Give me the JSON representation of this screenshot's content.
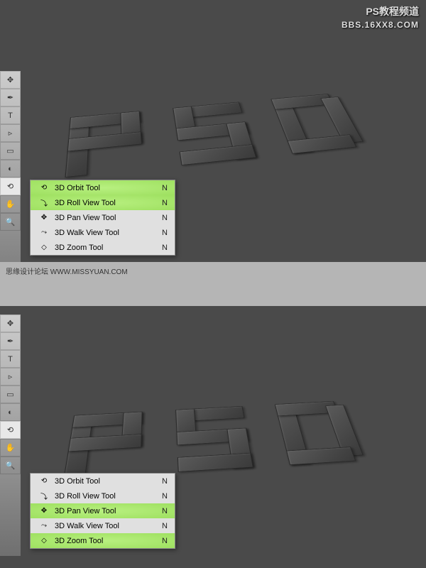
{
  "watermark": {
    "line1": "PS教程频道",
    "line2": "BBS.16XX8.COM"
  },
  "separator": {
    "text": "思缘设计论坛  WWW.MISSYUAN.COM"
  },
  "shortcut": "N",
  "menu_items": [
    {
      "label": "3D Orbit Tool",
      "icon": "⟲"
    },
    {
      "label": "3D Roll View Tool",
      "icon": "⤵"
    },
    {
      "label": "3D Pan View Tool",
      "icon": "✥"
    },
    {
      "label": "3D Walk View Tool",
      "icon": "⤳"
    },
    {
      "label": "3D Zoom Tool",
      "icon": "◇"
    }
  ],
  "panel1": {
    "highlights": [
      0,
      1
    ]
  },
  "panel2": {
    "highlights": [
      2,
      4
    ]
  },
  "tools": [
    "✥",
    "✒",
    "T",
    "▹",
    "▭",
    "◐",
    "⟲",
    "✋",
    "🔍"
  ]
}
